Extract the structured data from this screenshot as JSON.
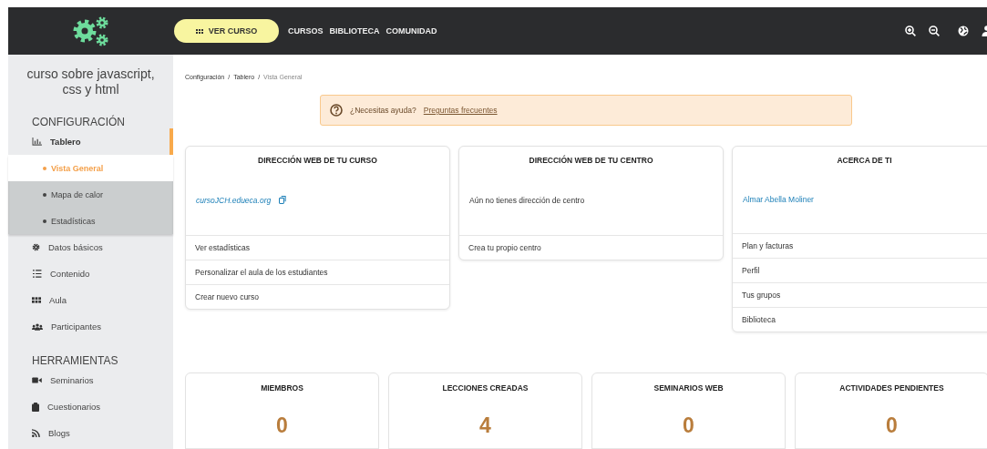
{
  "header": {
    "primary_button": "VER CURSO",
    "nav": [
      "CURSOS",
      "BIBLIOTECA",
      "COMUNIDAD"
    ]
  },
  "sidebar": {
    "course_title": "curso sobre javascript, css y html",
    "sections": [
      {
        "heading": "CONFIGURACIÓN",
        "items": [
          {
            "label": "Tablero",
            "selected": true,
            "expanded": true,
            "children": [
              {
                "label": "Vista General",
                "selected": true
              },
              {
                "label": "Mapa de calor",
                "selected": false
              },
              {
                "label": "Estadísticas",
                "selected": false
              }
            ]
          },
          {
            "label": "Datos básicos",
            "selected": false
          },
          {
            "label": "Contenido",
            "selected": false
          },
          {
            "label": "Aula",
            "selected": false
          },
          {
            "label": "Participantes",
            "selected": false
          }
        ]
      },
      {
        "heading": "HERRAMIENTAS",
        "items": [
          {
            "label": "Seminarios",
            "selected": false
          },
          {
            "label": "Cuestionarios",
            "selected": false
          },
          {
            "label": "Blogs",
            "selected": false
          }
        ]
      }
    ]
  },
  "breadcrumb": {
    "separator": "/",
    "items": [
      "Configuración",
      "Tablero",
      "Vista General"
    ]
  },
  "help_banner": {
    "text": "¿Necesitas ayuda?",
    "link": "Preguntas frecuentes"
  },
  "cards": [
    {
      "title": "DIRECCIÓN WEB DE TU CURSO",
      "body": {
        "kind": "url",
        "text": "cursoJCH.edueca.org"
      },
      "links": [
        "Ver estadísticas",
        "Personalizar el aula de los estudiantes",
        "Crear nuevo curso"
      ]
    },
    {
      "title": "DIRECCIÓN WEB DE TU CENTRO",
      "body": {
        "kind": "text",
        "text": "Aún no tienes dirección de centro"
      },
      "links": [
        "Crea tu propio centro"
      ]
    },
    {
      "title": "ACERCA DE TI",
      "body": {
        "kind": "name",
        "text": "Almar Abella Moliner"
      },
      "links": [
        "Plan y facturas",
        "Perfil",
        "Tus grupos",
        "Biblioteca"
      ]
    }
  ],
  "stats": [
    {
      "title": "MIEMBROS",
      "value": "0"
    },
    {
      "title": "LECCIONES CREADAS",
      "value": "4"
    },
    {
      "title": "SEMINARIOS WEB",
      "value": "0"
    },
    {
      "title": "ACTIVIDADES PENDIENTES",
      "value": "0"
    }
  ]
}
